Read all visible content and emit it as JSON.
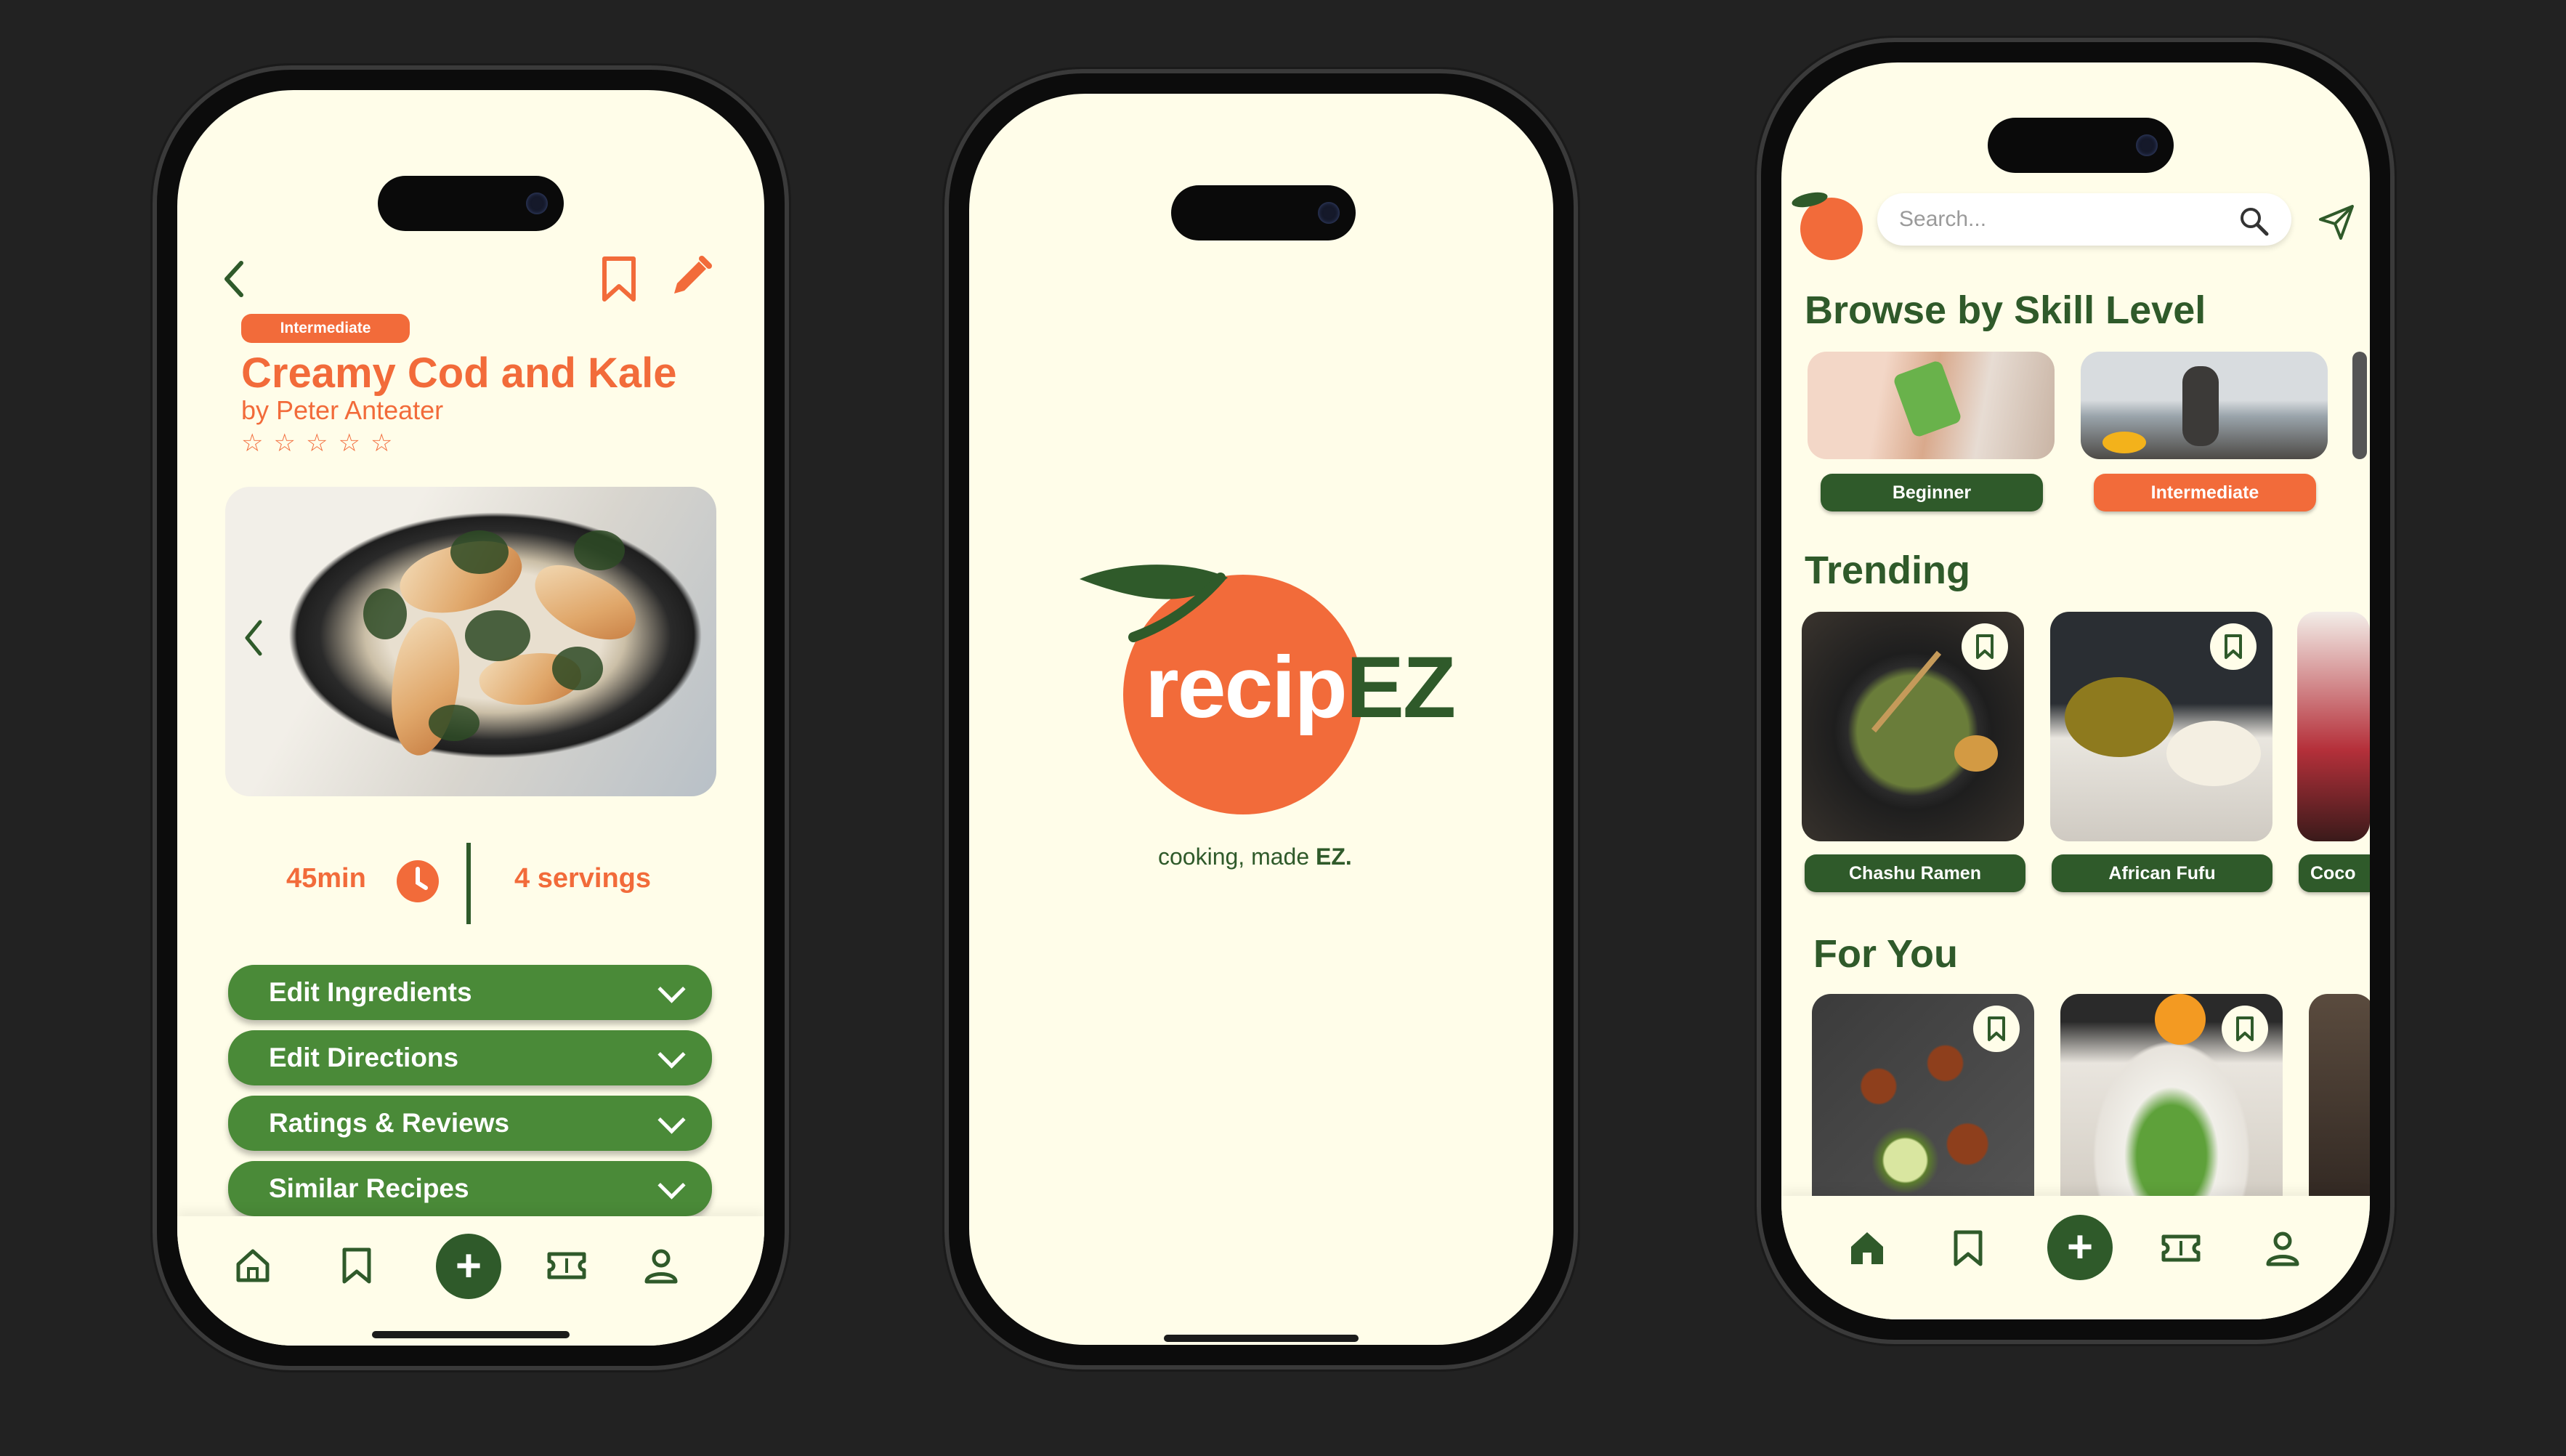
{
  "colors": {
    "orange": "#f26b3a",
    "dark_green": "#2f5a2a",
    "green": "#4a8a38",
    "cream": "#fffde9"
  },
  "recipe_screen": {
    "difficulty": "Intermediate",
    "title": "Creamy Cod and Kale",
    "author": "by Peter Anteater",
    "rating_stars": 5,
    "rating": 0,
    "time": "45min",
    "servings": "4 servings",
    "accordions": [
      {
        "label": "Edit Ingredients"
      },
      {
        "label": "Edit Directions"
      },
      {
        "label": "Ratings & Reviews"
      },
      {
        "label": "Similar Recipes"
      }
    ],
    "icons": [
      "back-icon",
      "bookmark-icon",
      "edit-pencil-icon",
      "carousel-prev-icon",
      "clock-icon"
    ]
  },
  "splash_screen": {
    "logo_main": "recip",
    "logo_accent": "EZ",
    "tagline_prefix": "cooking, made ",
    "tagline_accent": "EZ."
  },
  "home_screen": {
    "search_placeholder": "Search...",
    "sections": {
      "browse": "Browse by Skill Level",
      "trending": "Trending",
      "for_you": "For You"
    },
    "skill_levels": [
      {
        "label": "Beginner",
        "active": false
      },
      {
        "label": "Intermediate",
        "active": true
      }
    ],
    "trending": [
      {
        "label": "Chashu Ramen"
      },
      {
        "label": "African Fufu"
      },
      {
        "label": "Coco"
      }
    ]
  },
  "nav": [
    "home-icon",
    "bookmark-icon",
    "add-icon",
    "ticket-icon",
    "profile-icon"
  ]
}
